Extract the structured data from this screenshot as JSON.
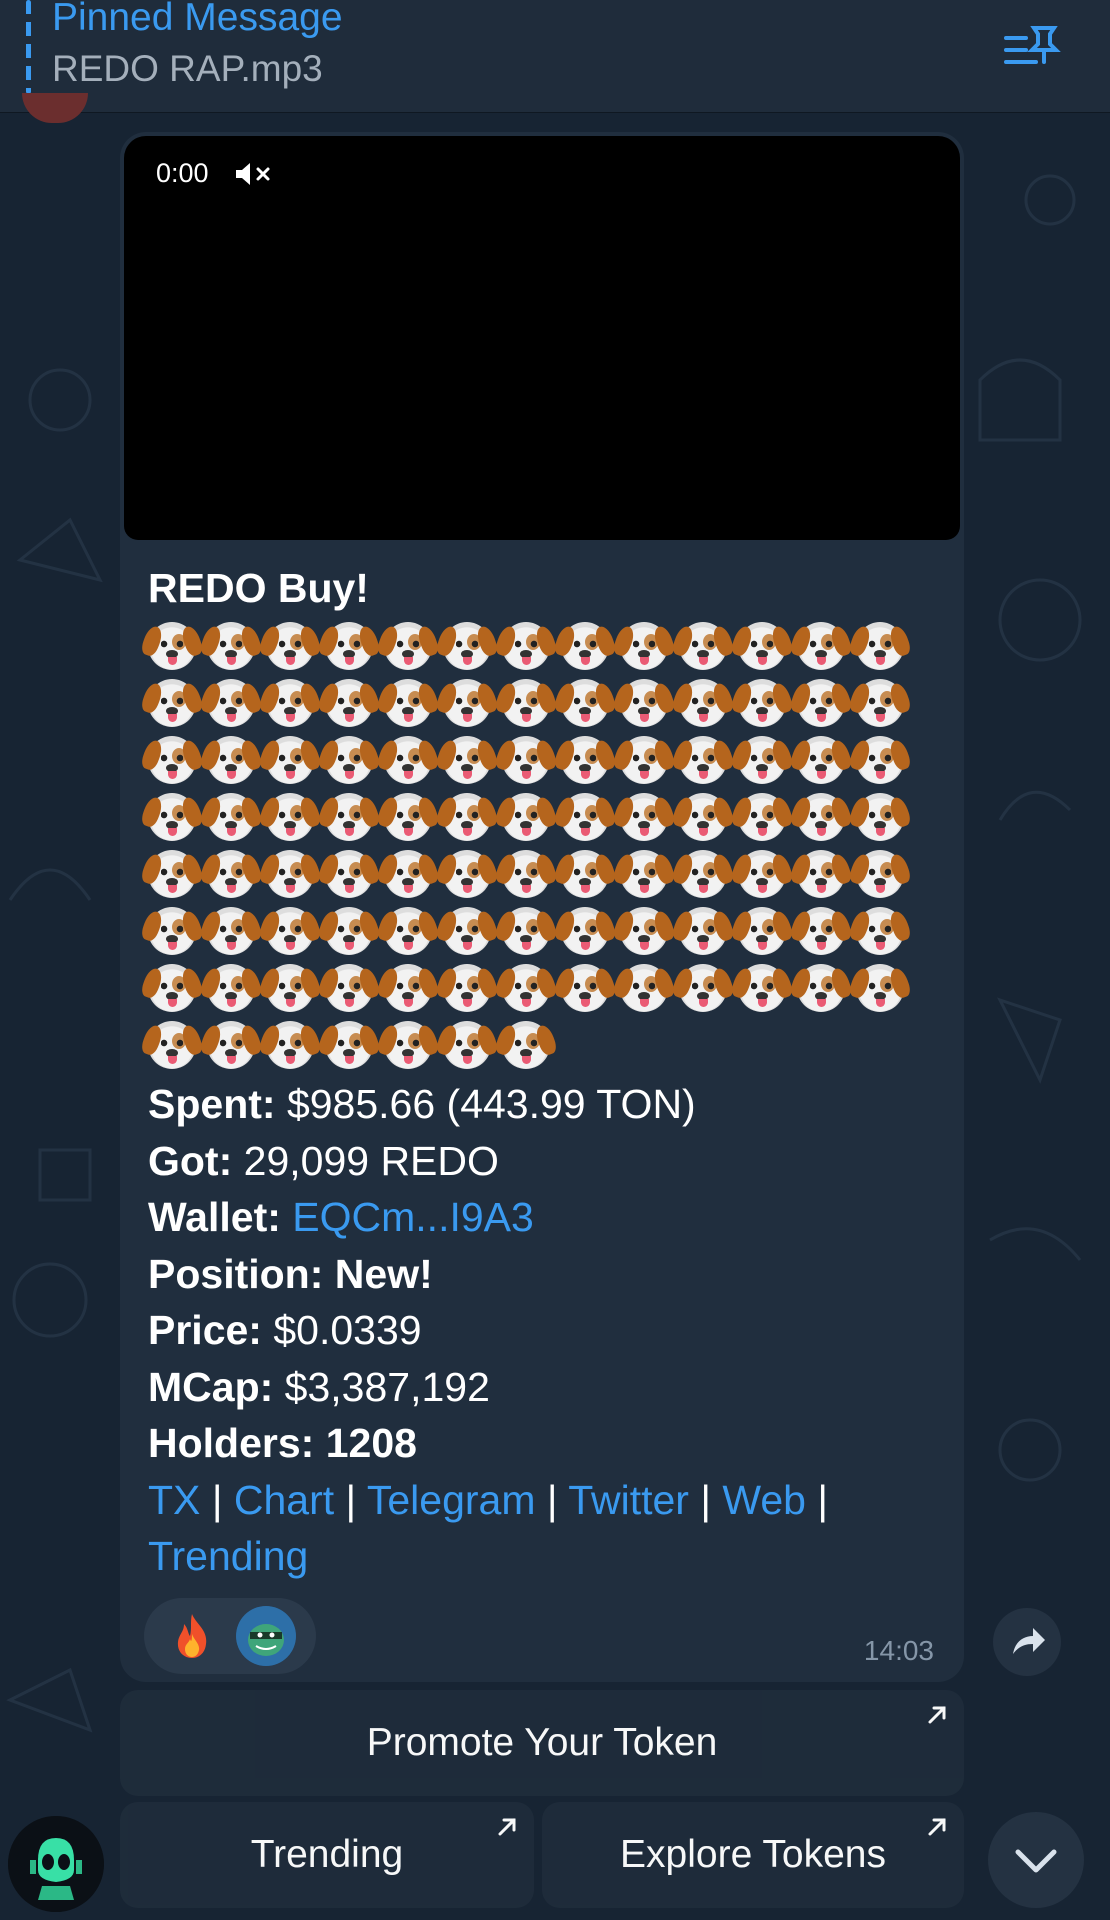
{
  "pinned": {
    "title": "Pinned Message",
    "subtitle": "REDO RAP.mp3"
  },
  "video": {
    "time": "0:00",
    "muted": true
  },
  "message": {
    "title": "REDO Buy!",
    "dog_emoji_count": 98,
    "dogs_per_row": 13,
    "stats": [
      {
        "label": "Spent:",
        "value": "$985.66 (443.99 TON)",
        "value_bold": false,
        "value_link": false
      },
      {
        "label": "Got:",
        "value": "29,099 REDO",
        "value_bold": false,
        "value_link": false
      },
      {
        "label": "Wallet:",
        "value": "EQCm...I9A3",
        "value_bold": false,
        "value_link": true
      },
      {
        "label": "Position:",
        "value": "New!",
        "value_bold": true,
        "value_link": false
      },
      {
        "label": "Price:",
        "value": "$0.0339",
        "value_bold": false,
        "value_link": false
      },
      {
        "label": "MCap:",
        "value": "$3,387,192",
        "value_bold": false,
        "value_link": false
      },
      {
        "label": "Holders:",
        "value": "1208",
        "value_bold": true,
        "value_link": false
      }
    ],
    "links": [
      "TX",
      "Chart",
      "Telegram",
      "Twitter",
      "Web",
      "Trending"
    ],
    "separator": "|",
    "time": "14:03"
  },
  "reactions": [
    "fire-emoji",
    "user-avatar"
  ],
  "keyboard": {
    "promote": "Promote Your Token",
    "trending": "Trending",
    "explore": "Explore Tokens"
  },
  "colors": {
    "background": "#172433",
    "bubble": "#202e3e",
    "link": "#3a9af0",
    "accent": "#3a9af0"
  }
}
